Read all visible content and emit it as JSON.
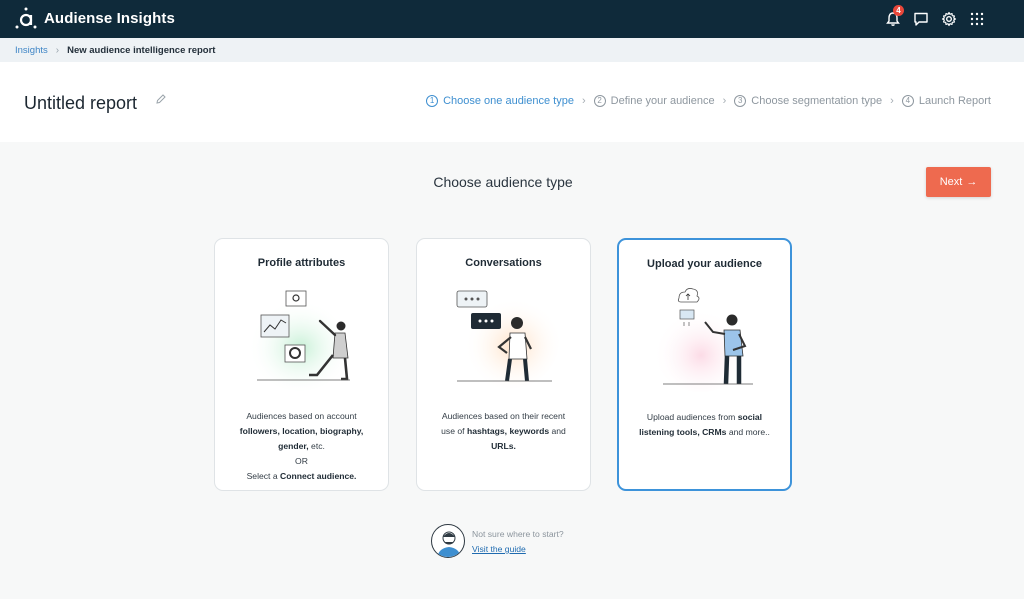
{
  "app": {
    "title": "Audiense Insights"
  },
  "topbar": {
    "icons": [
      "bell-icon",
      "chat-icon",
      "gear-icon",
      "apps-grid-icon"
    ],
    "notification_count": "4"
  },
  "breadcrumb": {
    "root": "Insights",
    "current": "New audience intelligence report"
  },
  "header": {
    "report_title": "Untitled report",
    "steps": [
      {
        "num": "1",
        "label": "Choose one audience type",
        "active": true
      },
      {
        "num": "2",
        "label": "Define your audience",
        "active": false
      },
      {
        "num": "3",
        "label": "Choose segmentation type",
        "active": false
      },
      {
        "num": "4",
        "label": "Launch Report",
        "active": false
      }
    ]
  },
  "main": {
    "title": "Choose audience type",
    "next_label": "Next",
    "cards": [
      {
        "title": "Profile attributes",
        "desc": {
          "l1": "Audiences based on account",
          "l2_b1": "followers, location, biography,",
          "l3_b1": "gender,",
          "l3_t1": " etc.",
          "l4": "OR",
          "l5_t1": "Select a ",
          "l5_b1": "Connect audience."
        }
      },
      {
        "title": "Conversations",
        "desc": {
          "l1": "Audiences based on their recent",
          "l2_t1": "use of ",
          "l2_b1": "hashtags, keywords",
          "l2_t2": " and",
          "l3_b1": "URLs."
        }
      },
      {
        "title": "Upload your audience",
        "selected": true,
        "desc": {
          "l1_t1": "Upload audiences from ",
          "l1_b1": "social",
          "l2_b1": "listening tools, CRMs",
          "l2_t1": " and more.."
        }
      }
    ]
  },
  "guide": {
    "question": "Not sure where to start?",
    "link": "Visit the guide"
  },
  "colors": {
    "topbar": "#0f2a3a",
    "accent": "#3e8fd0",
    "next_button": "#ee6a4f",
    "badge": "#e9473a"
  }
}
